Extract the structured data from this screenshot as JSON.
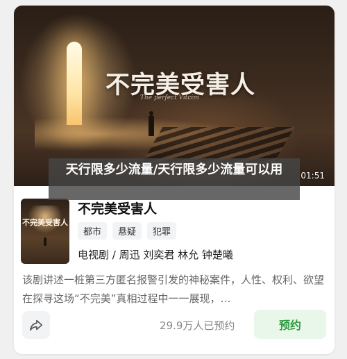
{
  "banner": {
    "title": "不完美受害人",
    "subtitle": "The perfect Vitcim",
    "duration": "01:51"
  },
  "caption": {
    "text": "天行限多少流量/天行限多少流量可以用"
  },
  "detail": {
    "poster_title": "不完美受害人",
    "title": "不完美受害人",
    "tags": [
      "都市",
      "悬疑",
      "犯罪"
    ],
    "meta": "电视剧 / 周迅 刘奕君 林允 钟楚曦",
    "description": "该剧讲述一桩第三方匿名报警引发的神秘案件，人性、权利、欲望在探寻这场“不完美”真相过程中一一展现，…"
  },
  "footer": {
    "share_icon": "share-icon",
    "reservations": "29.9万人已预约",
    "reserve_label": "预约",
    "accent_color": "#2e9a3f"
  }
}
